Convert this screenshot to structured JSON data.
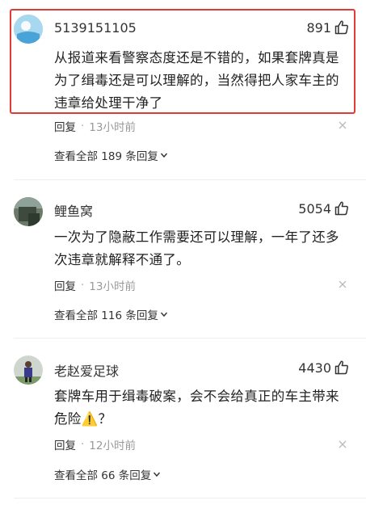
{
  "comments": [
    {
      "username": "5139151105",
      "likes": "891",
      "text_lines": [
        "从报道来看警察态度还是不错的，如果套牌真是",
        "为了缉毒还是可以理解的，当然得把人家车主的",
        "违章给处理干净了"
      ],
      "reply_label": "回复",
      "separator": "·",
      "time": "13小时前",
      "view_all": "查看全部 189 条回复"
    },
    {
      "username": "鲤鱼窝",
      "likes": "5054",
      "text_lines": [
        "一次为了隐蔽工作需要还可以理解，一年了还多",
        "次违章就解释不通了。"
      ],
      "reply_label": "回复",
      "separator": "·",
      "time": "13小时前",
      "view_all": "查看全部 116 条回复"
    },
    {
      "username": "老赵爱足球",
      "likes": "4430",
      "text_lines": [
        "套牌车用于缉毒破案，会不会给真正的车主带来",
        "危险⚠️？"
      ],
      "reply_label": "回复",
      "separator": "·",
      "time": "12小时前",
      "view_all": "查看全部 66 条回复"
    }
  ],
  "colors": {
    "highlight_border": "#e53935",
    "text": "#222222",
    "meta": "#999999"
  },
  "icons": {
    "like": "thumbs-up-icon",
    "dismiss": "close-icon",
    "expand": "chevron-down-icon"
  }
}
